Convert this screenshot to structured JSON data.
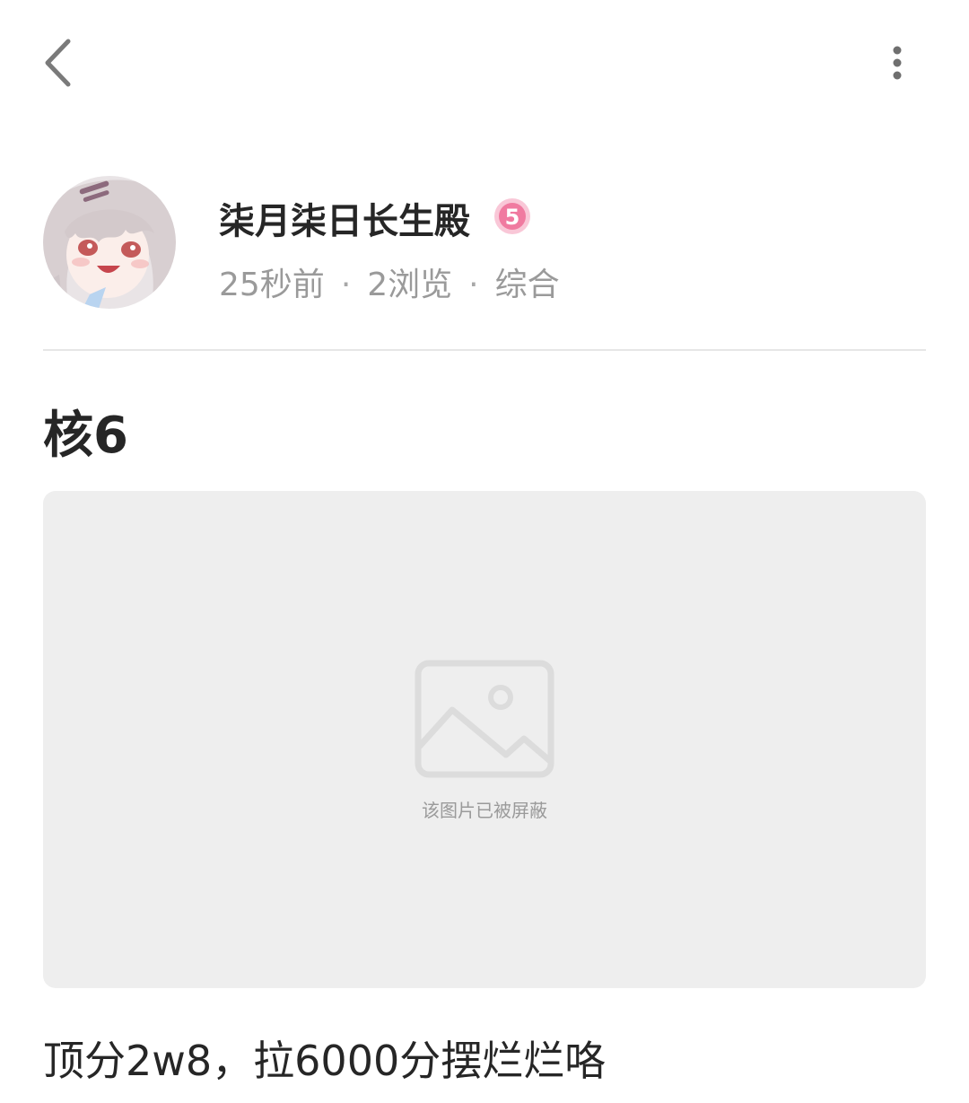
{
  "topbar": {
    "back_icon": "chevron-left-icon",
    "more_icon": "more-vertical-icon"
  },
  "author": {
    "name": "柒月柒日长生殿",
    "level": "5",
    "level_color": "#f07aa0",
    "time": "25秒前",
    "views": "2浏览",
    "category": "综合"
  },
  "post": {
    "title": "核6",
    "image_blocked_text": "该图片已被屏蔽",
    "body": "顶分2w8，拉6000分摆烂烂咯"
  }
}
